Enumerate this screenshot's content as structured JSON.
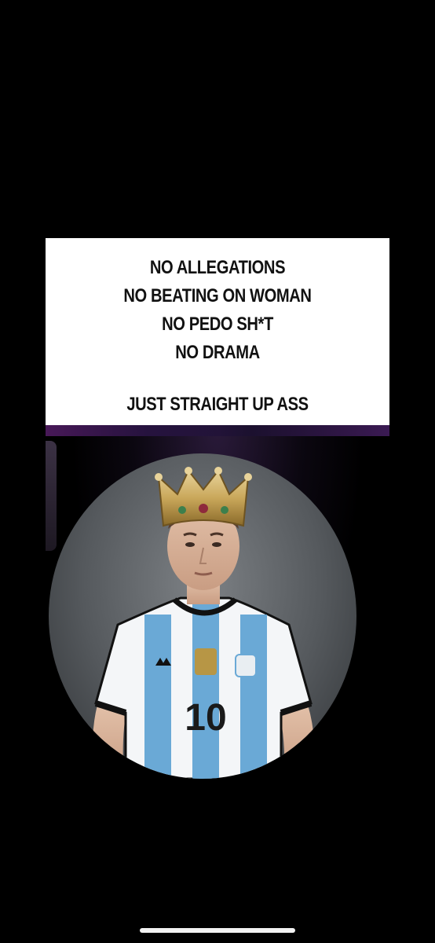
{
  "caption": {
    "lines": [
      "NO ALLEGATIONS",
      "NO BEATING ON WOMAN",
      "NO PEDO SH*T",
      "NO DRAMA"
    ],
    "punchline": "JUST STRAIGHT UP ASS"
  },
  "photo": {
    "jersey_number": "10",
    "subject": "man wearing a gold crown and a striped football jersey",
    "colors": {
      "jersey_blue": "#6aa9d6",
      "jersey_white": "#f4f6f8",
      "crown_gold": "#c9a75a",
      "background_gray": "#6b6f73"
    }
  }
}
